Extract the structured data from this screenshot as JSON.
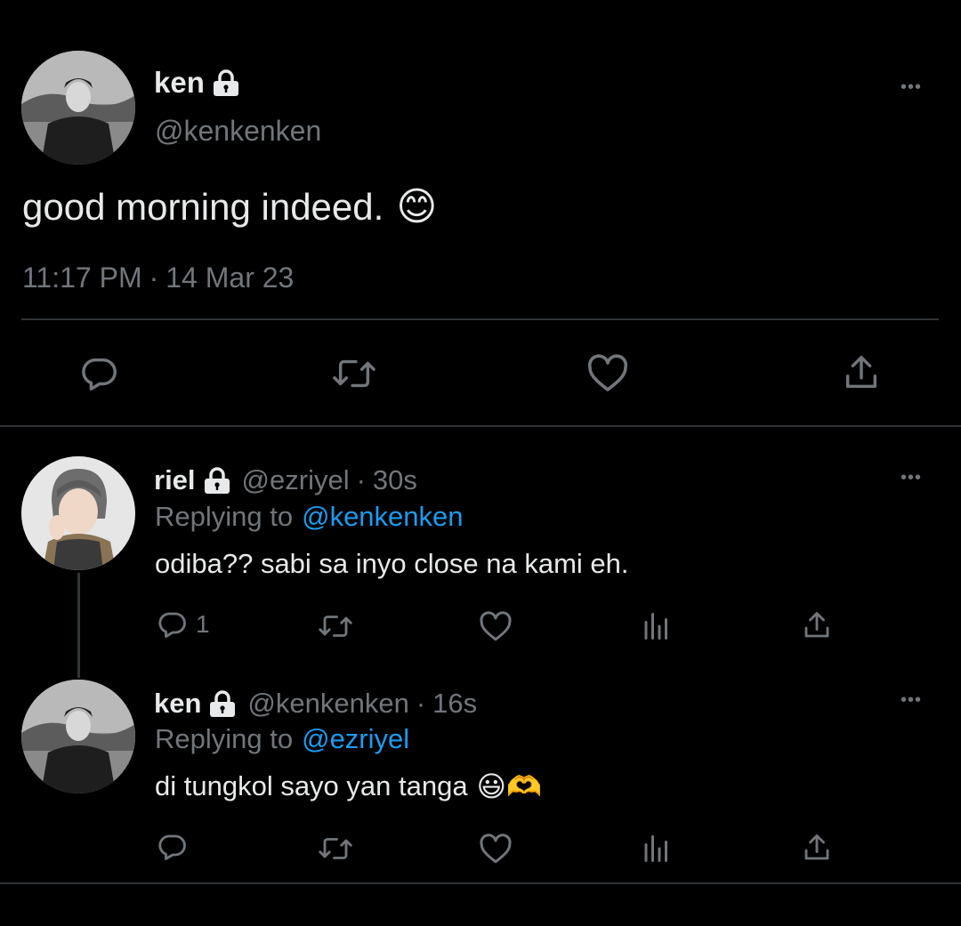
{
  "main_tweet": {
    "author_name": "ken",
    "author_handle": "@kenkenken",
    "text": "good morning indeed.",
    "emoji": "😊",
    "time": "11:17 PM",
    "separator": "·",
    "date": "14 Mar 23",
    "actions": [
      "reply-icon",
      "retweet-icon",
      "like-icon",
      "share-icon"
    ]
  },
  "replies": [
    {
      "author_name": "riel",
      "author_handle": "@ezriyel",
      "separator": "·",
      "age": "30s",
      "replying_prefix": "Replying to",
      "replying_to": "@kenkenken",
      "text": "odiba?? sabi sa inyo close na kami eh.",
      "reply_count": "1"
    },
    {
      "author_name": "ken",
      "author_handle": "@kenkenken",
      "separator": "·",
      "age": "16s",
      "replying_prefix": "Replying to",
      "replying_to": "@ezriyel",
      "text": "di tungkol sayo yan tanga",
      "emoji": "😃🫶",
      "reply_count": ""
    }
  ],
  "more_label": "•••",
  "colors": {
    "background": "#000000",
    "text": "#e7e9ea",
    "secondary": "#71767b",
    "link": "#1d9bf0",
    "divider": "#2f3336"
  }
}
